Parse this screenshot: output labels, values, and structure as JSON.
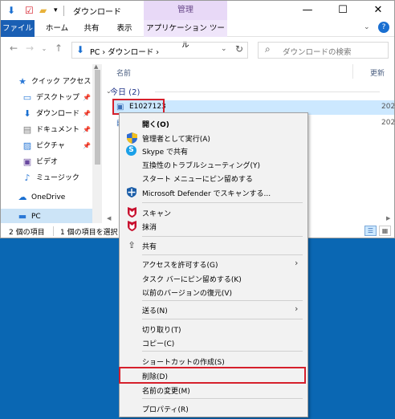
{
  "titlebar": {
    "title": "ダウンロード",
    "manage_tab": "管理",
    "minimize": "—",
    "maximize": "☐",
    "close": "✕"
  },
  "ribbon": {
    "tabs": [
      "ファイル",
      "ホーム",
      "共有",
      "表示",
      "アプリケーション ツール"
    ]
  },
  "address": {
    "path": "PC  ›  ダウンロード  ›",
    "search_placeholder": "ダウンロードの検索"
  },
  "nav": {
    "items": [
      {
        "icon": "★",
        "label": "クイック アクセス",
        "pin": ""
      },
      {
        "icon": "▭",
        "label": "デスクトップ",
        "pin": "📌"
      },
      {
        "icon": "⬇",
        "label": "ダウンロード",
        "pin": "📌"
      },
      {
        "icon": "▤",
        "label": "ドキュメント",
        "pin": "📌"
      },
      {
        "icon": "▨",
        "label": "ピクチャ",
        "pin": "📌"
      },
      {
        "icon": "▣",
        "label": "ビデオ",
        "pin": ""
      },
      {
        "icon": "♪",
        "label": "ミュージック",
        "pin": ""
      },
      {
        "icon": "☁",
        "label": "OneDrive",
        "pin": ""
      },
      {
        "icon": "▬",
        "label": "PC",
        "pin": ""
      }
    ]
  },
  "files": {
    "col_name": "名前",
    "col_updated": "更新",
    "group": "今日 (2)",
    "rows": [
      {
        "name": "E1027123",
        "date": "202"
      },
      {
        "name": "",
        "date": "202"
      }
    ]
  },
  "status": {
    "count": "2 個の項目",
    "selected": "1 個の項目を選択"
  },
  "menu": {
    "items": [
      {
        "label": "開く(O)",
        "icon": ""
      },
      {
        "label": "管理者として実行(A)",
        "icon": "shield"
      },
      {
        "label": "Skype で共有",
        "icon": "skype"
      },
      {
        "label": "互換性のトラブルシューティング(Y)",
        "icon": ""
      },
      {
        "label": "スタート メニューにピン留めする",
        "icon": ""
      },
      {
        "label": "Microsoft Defender でスキャンする...",
        "icon": "defender"
      },
      {
        "label": "スキャン",
        "icon": "mcafee"
      },
      {
        "label": "抹消",
        "icon": "mcafee"
      },
      {
        "label": "共有",
        "icon": "share"
      },
      {
        "label": "アクセスを許可する(G)",
        "icon": ""
      },
      {
        "label": "タスク バーにピン留めする(K)",
        "icon": ""
      },
      {
        "label": "以前のバージョンの復元(V)",
        "icon": ""
      },
      {
        "label": "送る(N)",
        "icon": ""
      },
      {
        "label": "切り取り(T)",
        "icon": ""
      },
      {
        "label": "コピー(C)",
        "icon": ""
      },
      {
        "label": "ショートカットの作成(S)",
        "icon": ""
      },
      {
        "label": "削除(D)",
        "icon": ""
      },
      {
        "label": "名前の変更(M)",
        "icon": ""
      },
      {
        "label": "プロパティ(R)",
        "icon": ""
      }
    ]
  },
  "colors": {
    "highlight": "#d6202c",
    "desktop": "#0a67b3",
    "file_tab": "#1a5fb4"
  }
}
